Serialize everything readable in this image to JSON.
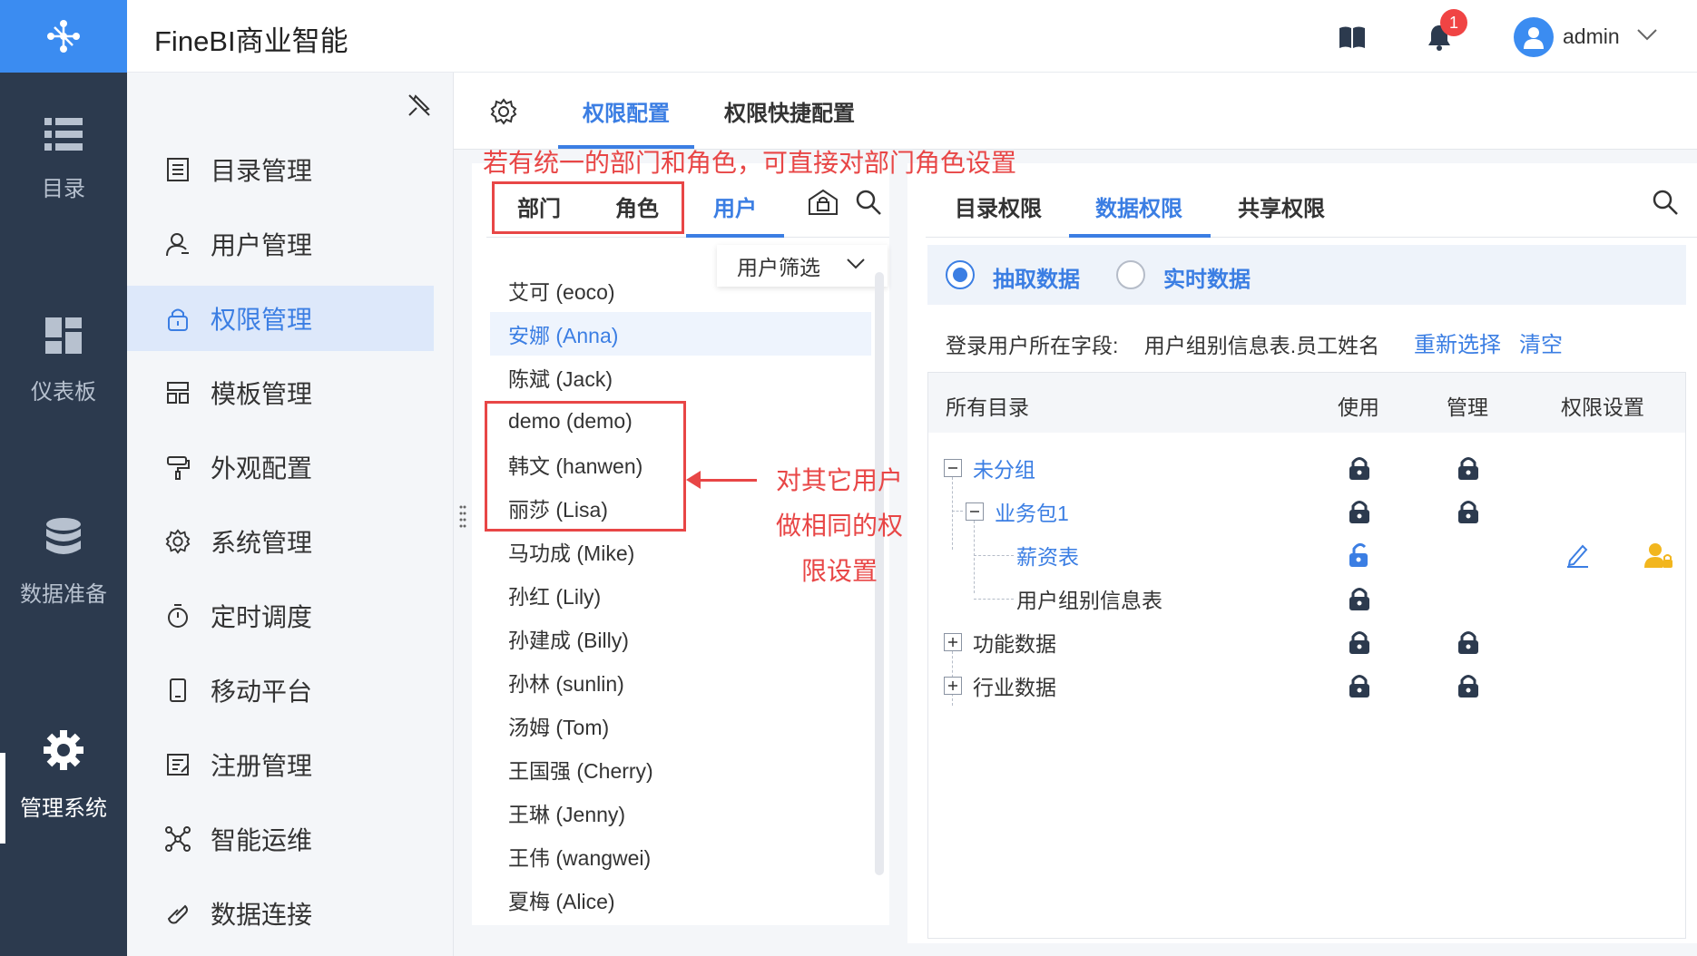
{
  "app_title": "FineBI商业智能",
  "header": {
    "notification_count": "1",
    "username": "admin"
  },
  "nav": [
    {
      "label": "目录",
      "icon": "list-icon"
    },
    {
      "label": "仪表板",
      "icon": "dashboard-icon"
    },
    {
      "label": "数据准备",
      "icon": "database-icon"
    },
    {
      "label": "管理系统",
      "icon": "gear-icon",
      "active": true
    }
  ],
  "sidebar": [
    {
      "label": "目录管理",
      "icon": "catalog-icon"
    },
    {
      "label": "用户管理",
      "icon": "user-icon"
    },
    {
      "label": "权限管理",
      "icon": "lock-icon",
      "active": true
    },
    {
      "label": "模板管理",
      "icon": "template-icon"
    },
    {
      "label": "外观配置",
      "icon": "paint-roller-icon"
    },
    {
      "label": "系统管理",
      "icon": "gear-icon"
    },
    {
      "label": "定时调度",
      "icon": "timer-icon"
    },
    {
      "label": "移动平台",
      "icon": "mobile-icon"
    },
    {
      "label": "注册管理",
      "icon": "register-icon"
    },
    {
      "label": "智能运维",
      "icon": "ops-icon"
    },
    {
      "label": "数据连接",
      "icon": "link-icon"
    }
  ],
  "top_tabs": {
    "perm_config": "权限配置",
    "quick_config": "权限快捷配置"
  },
  "left_tabs": {
    "dept": "部门",
    "role": "角色",
    "user": "用户"
  },
  "user_filter": "用户筛选",
  "users": [
    "艾可 (eoco)",
    "安娜 (Anna)",
    "陈斌 (Jack)",
    "demo (demo)",
    "韩文 (hanwen)",
    "丽莎 (Lisa)",
    "马功成 (Mike)",
    "孙红 (Lily)",
    "孙建成 (Billy)",
    "孙林 (sunlin)",
    "汤姆 (Tom)",
    "王国强 (Cherry)",
    "王琳 (Jenny)",
    "王伟 (wangwei)",
    "夏梅 (Alice)"
  ],
  "selected_user_index": 1,
  "right_tabs": {
    "dir": "目录权限",
    "data": "数据权限",
    "share": "共享权限"
  },
  "mode": {
    "extract": "抽取数据",
    "realtime": "实时数据",
    "selected": "extract"
  },
  "field": {
    "label": "登录用户所在字段:",
    "value": "用户组别信息表.员工姓名",
    "reselect": "重新选择",
    "clear": "清空"
  },
  "table_headers": {
    "all": "所有目录",
    "use": "使用",
    "manage": "管理",
    "perm": "权限设置"
  },
  "tree": [
    {
      "label": "未分组",
      "level": 0,
      "toggle": "minus",
      "link": true,
      "use": "locked",
      "manage": "locked"
    },
    {
      "label": "业务包1",
      "level": 1,
      "toggle": "minus",
      "link": true,
      "use": "locked",
      "manage": "locked"
    },
    {
      "label": "薪资表",
      "level": 2,
      "link": true,
      "use": "unlocked",
      "manage": "",
      "perm": true
    },
    {
      "label": "用户组别信息表",
      "level": 2,
      "link": false,
      "use": "locked",
      "manage": ""
    },
    {
      "label": "功能数据",
      "level": 0,
      "toggle": "plus",
      "link": false,
      "use": "locked",
      "manage": "locked"
    },
    {
      "label": "行业数据",
      "level": 0,
      "toggle": "plus",
      "link": false,
      "use": "locked",
      "manage": "locked"
    }
  ],
  "annotations": {
    "top": "若有统一的部门和角色，可直接对部门角色设置",
    "right": "对其它用户做相同的权限设置"
  },
  "colors": {
    "nav_bg": "#2c3a4e",
    "accent": "#3b7ee3",
    "annotation": "#e84646"
  }
}
